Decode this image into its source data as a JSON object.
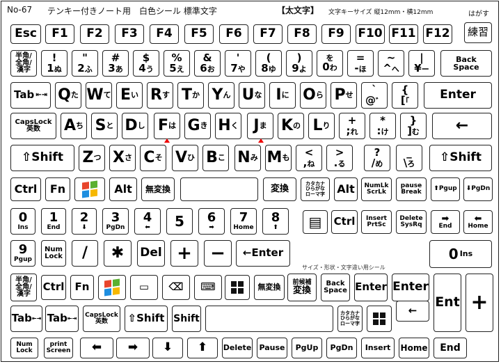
{
  "header": {
    "code": "No-67",
    "title": "テンキー付きノート用　白色シール 標準文字",
    "bold_tag": "【太文字】",
    "size_info": "文字キーサイズ 縦12mm・横12mm",
    "hagasu": "はがす"
  },
  "keys": {
    "esc": "Esc",
    "f1": "F1",
    "f2": "F2",
    "f3": "F3",
    "f4": "F4",
    "f5": "F5",
    "f6": "F6",
    "f7": "F7",
    "f8": "F8",
    "f9": "F9",
    "f10": "F10",
    "f11": "F11",
    "f12": "F12",
    "renshu": "練習",
    "hankaku_l1": "半角/",
    "hankaku_l2": "全角/",
    "hankaku_l3": "漢字",
    "n1": "1",
    "n1s": "!",
    "n1k": "ぬ",
    "n2": "2",
    "n2s": "\"",
    "n2k": "ふ",
    "n3": "3",
    "n3s": "#",
    "n3k": "あ",
    "n3k2": "ぁ",
    "n4": "4",
    "n4s": "$",
    "n4k": "う",
    "n4k2": "ぅ",
    "n5": "5",
    "n5s": "%",
    "n5k": "え",
    "n5k2": "ぇ",
    "n6": "6",
    "n6s": "&",
    "n6k": "お",
    "n6k2": "ぉ",
    "n7": "7",
    "n7s": "'",
    "n7k": "や",
    "n7k2": "ゃ",
    "n8": "8",
    "n8s": "(",
    "n8k": "ゆ",
    "n8k2": "ゅ",
    "n9": "9",
    "n9s": ")",
    "n9k": "よ",
    "n9k2": "ょ",
    "n0": "0",
    "n0k": "わ",
    "n0k2": "を",
    "minus": "-",
    "minus_s": "=",
    "minus_k": "ほ",
    "caret": "^",
    "caret_s": "~",
    "caret_k": "へ",
    "yen": "¥",
    "yen_s": "|",
    "yen_k": "ー",
    "backspace_l1": "Back",
    "backspace_l2": "Space",
    "tab": "Tab",
    "q": "Q",
    "qk": "た",
    "w": "W",
    "wk": "て",
    "e": "E",
    "ek": "い",
    "r": "R",
    "rk": "す",
    "t": "T",
    "tk": "か",
    "y": "Y",
    "yk": "ん",
    "u": "U",
    "uk": "な",
    "i": "I",
    "ik": "に",
    "o": "O",
    "ok": "ら",
    "p": "P",
    "pk": "せ",
    "at": "@",
    "at_s": "`",
    "at_k": "゛",
    "bracket": "[",
    "bracket_s": "{",
    "bracket_k": "「",
    "enter": "Enter",
    "caps_l1": "CapsLock",
    "caps_l2": "英数",
    "a": "A",
    "ak": "ち",
    "s": "S",
    "sk": "と",
    "d": "D",
    "dk": "し",
    "f": "F",
    "fk": "は",
    "g": "G",
    "gk": "き",
    "h": "H",
    "hk": "く",
    "j": "J",
    "jk": "ま",
    "k": "K",
    "kk": "の",
    "l": "L",
    "lk": "り",
    "semi": ";",
    "semi_s": "+",
    "semi_k": "れ",
    "colon": ":",
    "colon_s": "*",
    "colon_k": "け",
    "rbr": "]",
    "rbr_s": "}",
    "rbr_k": "む",
    "enter_arrow": "←",
    "shift": "⇧Shift",
    "z": "Z",
    "zk": "つ",
    "x": "X",
    "xk": "さ",
    "c": "C",
    "ck": "そ",
    "v": "V",
    "vk": "ひ",
    "b": "B",
    "bk": "こ",
    "n": "N",
    "nk": "み",
    "m": "M",
    "mk": "も",
    "comma": ",",
    "comma_s": "<",
    "comma_k": "ね",
    "period": ".",
    "period_s": ">",
    "period_k": "る",
    "slash": "/",
    "slash_s": "?",
    "slash_k": "め",
    "bslash": "\\",
    "bslash_s": "_",
    "bslash_k": "ろ",
    "ctrl": "Ctrl",
    "fn": "Fn",
    "alt": "Alt",
    "muhenkan": "無変換",
    "henkan": "変換",
    "kana_l1": "カタカナ",
    "kana_l2": "ひらがな",
    "kana_l3": "ローマ字",
    "numlk_l1": "NumLk",
    "numlk_l2": "ScrLk",
    "pause_l1": "pause",
    "pause_l2": "Break",
    "pgup_arrow": "⬆Pgup",
    "pgdn_arrow": "⬇PgDn",
    "np0": "0",
    "np0s": "Ins",
    "np1": "1",
    "np1s": "End",
    "np2": "2",
    "np2s": "⬇",
    "np3": "3",
    "np3s": "PgDn",
    "np4": "4",
    "np4s": "⬅",
    "np5": "5",
    "np6": "6",
    "np6s": "➡",
    "np7": "7",
    "np7s": "Home",
    "np8": "8",
    "np8s": "⬆",
    "np9": "9",
    "np9s": "Pgup",
    "menu": "▤",
    "ins_l1": "Insert",
    "ins_l2": "PrtSc",
    "del_l1": "Delete",
    "del_l2": "SysRq",
    "end_arrow": "➡",
    "end_label": "End",
    "home_arrow": "⬅",
    "home_label": "Home",
    "numlock_l1": "Num",
    "numlock_l2": "Lock",
    "np_slash": "/",
    "np_star": "✱",
    "np_del": "Del",
    "np_plus": "+",
    "np_minus": "−",
    "np_enter": "Enter",
    "np_enter_arrow": "←",
    "zero_ins": "0",
    "zero_ins_s": "Ins",
    "spare_note": "サイズ・形状・文字違い用シール",
    "blank_key": "▭",
    "bs_icon": "⌫",
    "kb_icon": "⌨",
    "zenkouho_l1": "前候補",
    "zenkouho_l2": "変換",
    "ent": "Ent",
    "plus": "+",
    "shift_plain": "Shift",
    "print_l1": "print",
    "print_l2": "Screen",
    "arrow_left": "⬅",
    "arrow_right": "➡",
    "arrow_down": "⬇",
    "arrow_up": "⬆",
    "delete_w": "Delete",
    "pause_w": "Pause",
    "pgup_w": "PgUp",
    "pgdn_w": "PgDn",
    "insert_w": "Insert",
    "home_w": "Home",
    "end_w": "End"
  },
  "colors": {
    "accent_red": "#e00000",
    "win_red": "#e8452c",
    "win_green": "#5bb030",
    "win_blue": "#1e8ee0",
    "win_yellow": "#f6b800"
  }
}
